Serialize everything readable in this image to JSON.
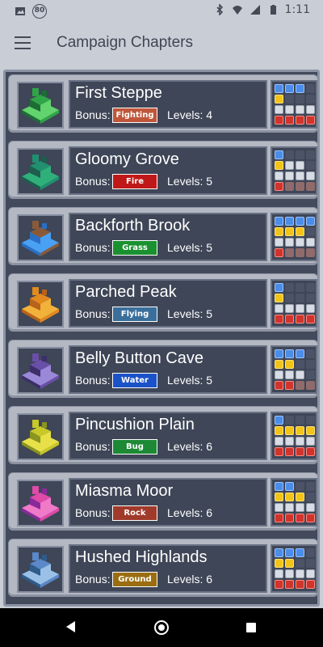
{
  "status_bar": {
    "notification_badge": "80",
    "time": "1:11",
    "icons": [
      "image-icon",
      "bluetooth-icon",
      "wifi-icon",
      "signal-icon",
      "battery-icon"
    ]
  },
  "app_bar": {
    "title": "Campaign Chapters",
    "menu_icon": "hamburger-menu-icon"
  },
  "chapters": [
    {
      "name": "First Steppe",
      "bonus_label": "Bonus:",
      "bonus": "Fighting",
      "bonus_color": "#c0563a",
      "levels": "Levels: 4",
      "thumb_colors": [
        "#2fa548",
        "#62d36d",
        "#1c6e35"
      ],
      "grid": [
        1,
        1,
        1,
        0,
        2,
        0,
        0,
        0,
        3,
        3,
        3,
        3,
        4,
        4,
        4,
        4
      ]
    },
    {
      "name": "Gloomy Grove",
      "bonus_label": "Bonus:",
      "bonus": "Fire",
      "bonus_color": "#c01818",
      "levels": "Levels: 5",
      "thumb_colors": [
        "#20906e",
        "#2fb07a",
        "#1d5e4e"
      ],
      "grid": [
        1,
        0,
        0,
        0,
        2,
        3,
        3,
        0,
        3,
        3,
        3,
        3,
        4,
        5,
        5,
        5
      ]
    },
    {
      "name": "Backforth Brook",
      "bonus_label": "Bonus:",
      "bonus": "Grass",
      "bonus_color": "#1a9130",
      "levels": "Levels: 5",
      "thumb_colors": [
        "#8a5a38",
        "#4aa0f2",
        "#2a6fc4"
      ],
      "grid": [
        1,
        1,
        1,
        1,
        2,
        2,
        2,
        0,
        3,
        3,
        3,
        3,
        4,
        5,
        5,
        5
      ]
    },
    {
      "name": "Parched Peak",
      "bonus_label": "Bonus:",
      "bonus": "Flying",
      "bonus_color": "#3a6f9c",
      "levels": "Levels: 5",
      "thumb_colors": [
        "#e28a1e",
        "#f2b23a",
        "#b8621a"
      ],
      "grid": [
        1,
        0,
        0,
        0,
        2,
        0,
        0,
        0,
        3,
        3,
        3,
        3,
        4,
        4,
        4,
        4
      ]
    },
    {
      "name": "Belly Button Cave",
      "bonus_label": "Bonus:",
      "bonus": "Water",
      "bonus_color": "#1c52c8",
      "levels": "Levels: 5",
      "thumb_colors": [
        "#6a4fa8",
        "#9a88d8",
        "#3c2f6a"
      ],
      "grid": [
        1,
        1,
        1,
        0,
        2,
        2,
        0,
        0,
        3,
        3,
        3,
        0,
        4,
        4,
        5,
        5
      ]
    },
    {
      "name": "Pincushion Plain",
      "bonus_label": "Bonus:",
      "bonus": "Bug",
      "bonus_color": "#1c8a34",
      "levels": "Levels: 6",
      "thumb_colors": [
        "#c8c828",
        "#e8e048",
        "#8a9420"
      ],
      "grid": [
        1,
        0,
        0,
        0,
        2,
        2,
        2,
        2,
        3,
        3,
        3,
        3,
        4,
        4,
        4,
        4
      ]
    },
    {
      "name": "Miasma Moor",
      "bonus_label": "Bonus:",
      "bonus": "Rock",
      "bonus_color": "#a03a2a",
      "levels": "Levels: 6",
      "thumb_colors": [
        "#e04aa8",
        "#f07ac8",
        "#8a2a9a"
      ],
      "grid": [
        1,
        1,
        0,
        0,
        2,
        2,
        2,
        0,
        3,
        3,
        3,
        3,
        4,
        4,
        4,
        4
      ]
    },
    {
      "name": "Hushed Highlands",
      "bonus_label": "Bonus:",
      "bonus": "Ground",
      "bonus_color": "#9a6e10",
      "levels": "Levels: 6",
      "thumb_colors": [
        "#5a88c8",
        "#9ac0e8",
        "#2f5c8a"
      ],
      "grid": [
        1,
        1,
        1,
        0,
        2,
        2,
        0,
        0,
        3,
        3,
        3,
        3,
        4,
        4,
        4,
        4
      ]
    }
  ],
  "nav_bar": {
    "back_icon": "back-icon",
    "home_icon": "home-icon",
    "recents_icon": "recents-icon"
  }
}
